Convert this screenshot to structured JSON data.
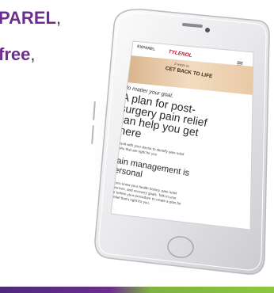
{
  "headline": {
    "line1": "PAREL",
    "line1_punct": ",",
    "line2": "free",
    "line2_punct": ","
  },
  "screen": {
    "brand_left": "EXPAREL",
    "brand_right": "TYLENOL",
    "hero_kicker": "2 ways to",
    "hero_title": "CET BACK TO LIFE",
    "intro": "No matter your goal,",
    "headline_lines": [
      "A plan for post-",
      "surgery pain relief",
      "can help you get",
      "there"
    ],
    "consult_lines": [
      "Consult with your doctor to identify pain relief",
      "options that are right for you"
    ],
    "section_lines": [
      "Pain management is",
      "personal"
    ],
    "body_lines": [
      "Only you know your health history, pain relief",
      "preferences, and recovery goals. Talk to your",
      "doctor before your procedure to create a plan for",
      "pain relief that's right for you."
    ]
  },
  "colors": {
    "headline_purple": "#6b2d8f",
    "accent_green": "#8ec63f",
    "tylenol_red": "#c8102e"
  }
}
